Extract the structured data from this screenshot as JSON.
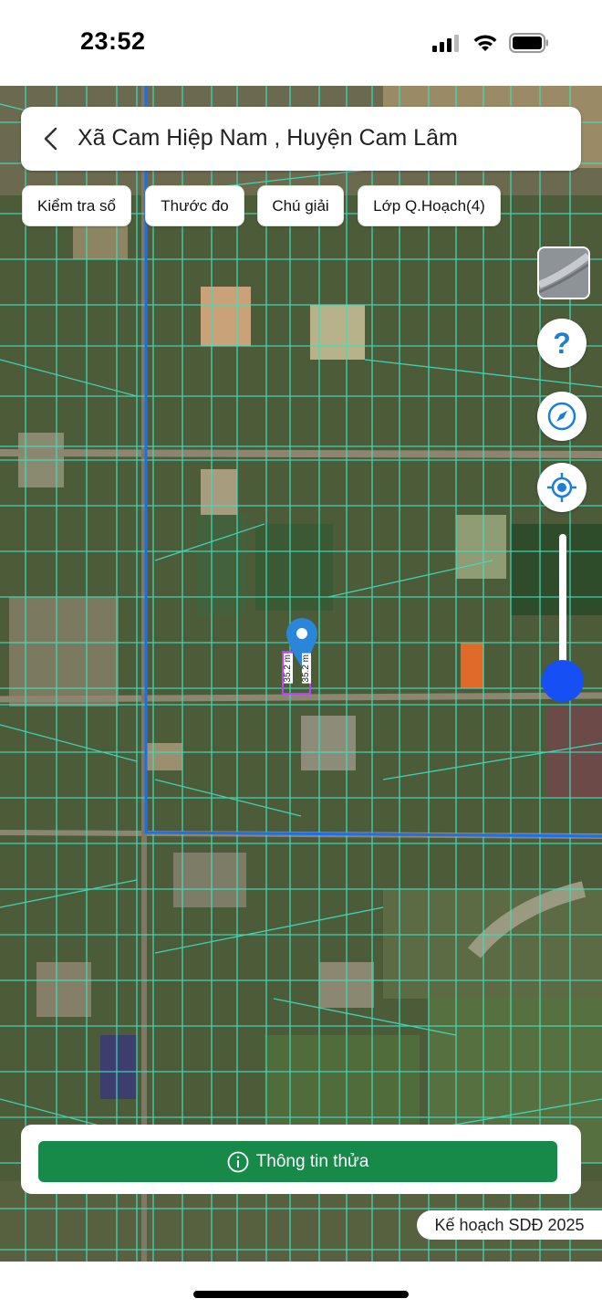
{
  "status_bar": {
    "time": "23:52",
    "icons": [
      "cellular-signal-icon",
      "wifi-icon",
      "battery-icon"
    ]
  },
  "header": {
    "back_icon": "chevron-left-icon",
    "location_title": "Xã Cam Hiệp Nam , Huyện Cam Lâm"
  },
  "toolbar": {
    "chips": [
      {
        "label": "Kiểm tra sổ"
      },
      {
        "label": "Thước đo"
      },
      {
        "label": "Chú giải"
      },
      {
        "label": "Lớp Q.Hoạch(4)"
      }
    ]
  },
  "map_controls": {
    "layer_icon": "satellite-layer-icon",
    "help_icon": "help-icon",
    "compass_icon": "compass-icon",
    "locate_icon": "my-location-icon",
    "opacity_slider_value": 1.0
  },
  "map": {
    "pin_icon": "map-pin-icon",
    "parcel_measurements": [
      "35.2 m",
      "35.2 m"
    ],
    "colors": {
      "parcel_lines": "#3fe0c0",
      "boundary_line": "#1e6ff0",
      "selected_parcel": "#c040ff"
    }
  },
  "bottom_panel": {
    "info_icon": "info-icon",
    "button_label": "Thông tin thửa",
    "button_color": "#178a4a"
  },
  "map_badge": {
    "label": "Kế hoạch SDĐ 2025"
  }
}
